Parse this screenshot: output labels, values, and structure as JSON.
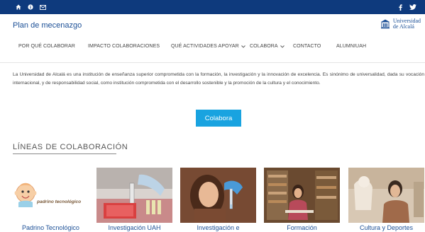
{
  "topbar": {
    "left_icons": [
      "home-icon",
      "info-icon",
      "mail-icon"
    ],
    "right_icons": [
      "facebook-icon",
      "twitter-icon"
    ],
    "background": "#0e3a7d"
  },
  "header": {
    "title": "Plan de mecenazgo",
    "logo": {
      "line1": "Universidad",
      "line2": "de Alcalá"
    }
  },
  "nav": {
    "items": [
      {
        "label": "POR QUÉ COLABORAR",
        "dropdown": false
      },
      {
        "label": "IMPACTO COLABORACIONES",
        "dropdown": false
      },
      {
        "label": "QUÉ ACTIVIDADES APOYAR",
        "dropdown": true
      },
      {
        "label": "COLABORA",
        "dropdown": true
      },
      {
        "label": "CONTACTO",
        "dropdown": false
      },
      {
        "label": "ALUMNIUAH",
        "dropdown": false
      }
    ]
  },
  "intro": {
    "text": "La Universidad de Alcalá es una institución de enseñanza superior comprometida con la formación, la investigación y la innovación de excelencia. Es sinónimo de universalidad, dada su vocación internacional, y de responsabilidad social, como institución comprometida con el desarrollo sostenible y la promoción de la cultura y el conocimiento."
  },
  "cta": {
    "label": "Colabora",
    "color": "#19a3e0"
  },
  "section": {
    "title": "LÍNEAS DE COLABORACIÓN"
  },
  "cards": [
    {
      "caption": "Padrino Tecnológico",
      "logo_text": "padrino tecnológico"
    },
    {
      "caption": "Investigación UAH"
    },
    {
      "caption": "Investigación e"
    },
    {
      "caption": "Formación"
    },
    {
      "caption": "Cultura y Deportes"
    }
  ]
}
